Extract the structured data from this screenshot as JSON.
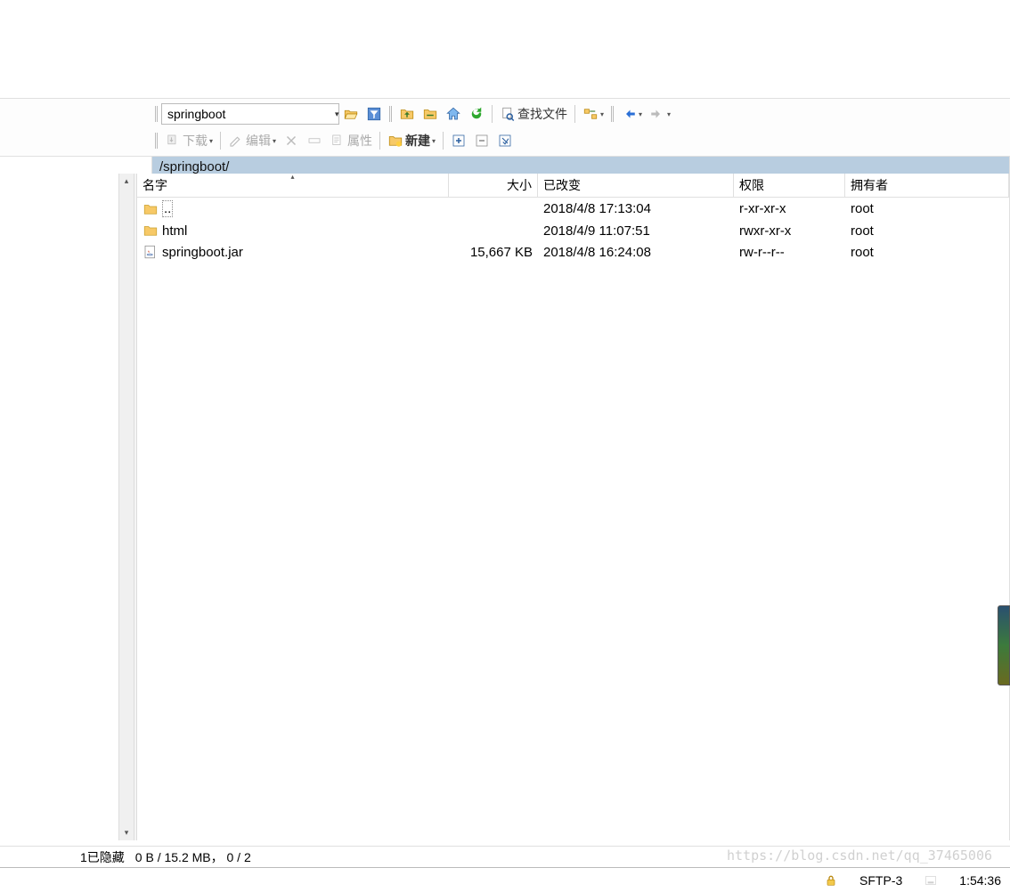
{
  "address": {
    "folder_name": "springboot"
  },
  "toolbar": {
    "download_label": "下载",
    "edit_label": "编辑",
    "properties_label": "属性",
    "new_label": "新建",
    "find_label": "查找文件"
  },
  "path_bar": {
    "path": "/springboot/"
  },
  "columns": {
    "name": "名字",
    "size": "大小",
    "changed": "已改变",
    "permissions": "权限",
    "owner": "拥有者"
  },
  "files": [
    {
      "icon": "folder-up",
      "name": "..",
      "size": "",
      "changed": "2018/4/8 17:13:04",
      "perm": "r-xr-xr-x",
      "owner": "root"
    },
    {
      "icon": "folder",
      "name": "html",
      "size": "",
      "changed": "2018/4/9 11:07:51",
      "perm": "rwxr-xr-x",
      "owner": "root"
    },
    {
      "icon": "java",
      "name": "springboot.jar",
      "size": "15,667 KB",
      "changed": "2018/4/8 16:24:08",
      "perm": "rw-r--r--",
      "owner": "root"
    }
  ],
  "bottom_status": {
    "hidden_label": "1已隐藏",
    "selection": "0 B / 15.2 MB，  0 / 2"
  },
  "status_bar": {
    "protocol": "SFTP-3",
    "time": "1:54:36"
  },
  "watermark": "https://blog.csdn.net/qq_37465006"
}
